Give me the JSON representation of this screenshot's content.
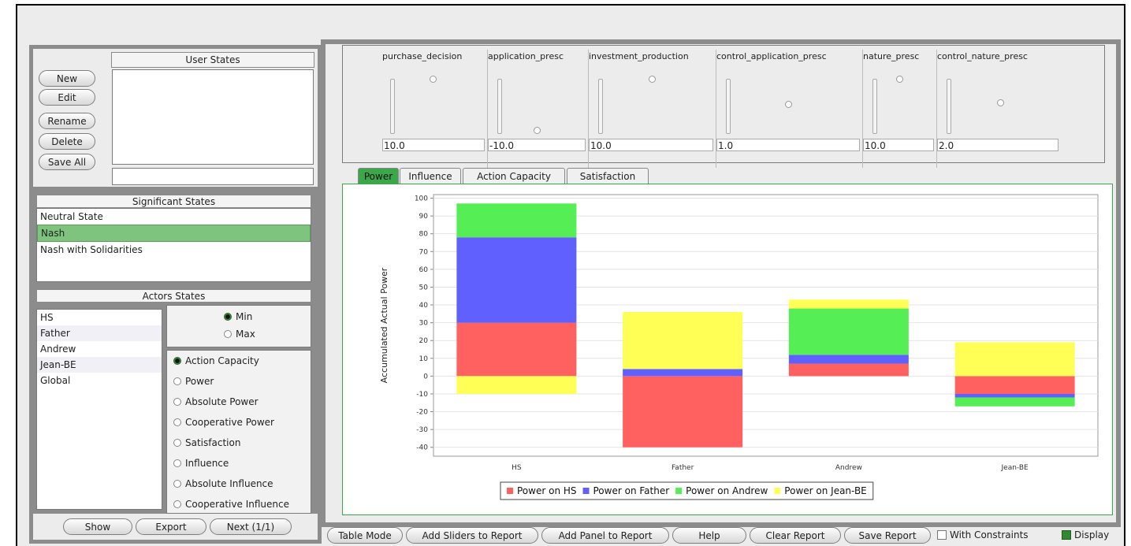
{
  "user_states": {
    "header": "User States",
    "buttons": [
      "New",
      "Edit",
      "Rename",
      "Delete",
      "Save All"
    ]
  },
  "significant_states": {
    "header": "Significant States",
    "items": [
      "Neutral State",
      "Nash",
      "Nash with Solidarities"
    ],
    "selected": "Nash"
  },
  "actors_states": {
    "header": "Actors States",
    "actors": [
      "HS",
      "Father",
      "Andrew",
      "Jean-BE",
      "Global"
    ],
    "minmax": [
      "Min",
      "Max"
    ],
    "minmax_selected": "Min",
    "metrics": [
      "Action Capacity",
      "Power",
      "Absolute Power",
      "Cooperative Power",
      "Satisfaction",
      "Influence",
      "Absolute Influence",
      "Cooperative Influence"
    ],
    "metric_selected": "Action Capacity"
  },
  "bottom_left_buttons": [
    "Show",
    "Export",
    "Next (1/1)"
  ],
  "sliders": [
    {
      "name": "purchase_decision",
      "value": "10.0",
      "level": 1.0
    },
    {
      "name": "application_presc",
      "value": "-10.0",
      "level": 0.0
    },
    {
      "name": "investment_production",
      "value": "10.0",
      "level": 1.0
    },
    {
      "name": "control_application_presc",
      "value": "1.0",
      "level": 0.55
    },
    {
      "name": "nature_presc",
      "value": "10.0",
      "level": 1.0
    },
    {
      "name": "control_nature_presc",
      "value": "2.0",
      "level": 0.6
    }
  ],
  "tabs": [
    "Power",
    "Influence",
    "Action Capacity",
    "Satisfaction"
  ],
  "active_tab": "Power",
  "chart_data": {
    "type": "bar",
    "stacked": true,
    "categories": [
      "HS",
      "Father",
      "Andrew",
      "Jean-BE"
    ],
    "ylabel": "Accumulated Actual Power",
    "ylim": [
      -45,
      102
    ],
    "yticks": [
      100,
      90,
      80,
      70,
      60,
      50,
      40,
      30,
      20,
      10,
      0,
      -10,
      -20,
      -30,
      -40
    ],
    "series": [
      {
        "name": "Power on HS",
        "color": "#ff6060",
        "values": [
          30,
          -40,
          7,
          -10
        ]
      },
      {
        "name": "Power on Father",
        "color": "#6060ff",
        "values": [
          48,
          4,
          5,
          -2
        ]
      },
      {
        "name": "Power on Andrew",
        "color": "#55ee55",
        "values": [
          19,
          0,
          26,
          -5
        ]
      },
      {
        "name": "Power on Jean-BE",
        "color": "#ffff55",
        "values": [
          -10,
          32,
          5,
          19
        ]
      }
    ],
    "legend_position": "bottom",
    "grid": true
  },
  "bottom_buttons": [
    "Table Mode",
    "Add Sliders to Report",
    "Add Panel to Report",
    "Help",
    "Clear Report",
    "Save Report"
  ],
  "checkboxes": [
    {
      "label": "With Constraints",
      "checked": false
    },
    {
      "label": "Display",
      "checked": true
    }
  ]
}
